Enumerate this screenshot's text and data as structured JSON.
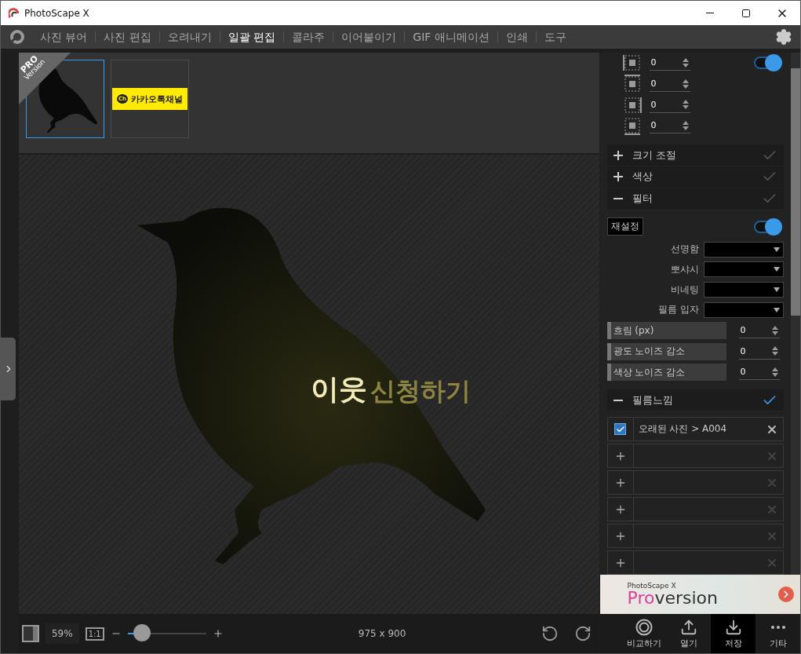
{
  "window": {
    "title": "PhotoScape X"
  },
  "nav": [
    {
      "label": "사진 뷰어",
      "selected": false
    },
    {
      "label": "사진 편집",
      "selected": false
    },
    {
      "label": "오려내기",
      "selected": false
    },
    {
      "label": "일괄 편집",
      "selected": true
    },
    {
      "label": "콜라주",
      "selected": false
    },
    {
      "label": "이어붙이기",
      "selected": false
    },
    {
      "label": "GIF 애니메이션",
      "selected": false
    },
    {
      "label": "인쇄",
      "selected": false
    },
    {
      "label": "도구",
      "selected": false
    }
  ],
  "pro_badge": {
    "title": "PRO",
    "subtitle": "Version"
  },
  "thumbnails": [
    {
      "kind": "bird",
      "selected": true
    },
    {
      "kind": "banner",
      "selected": false,
      "label": "카카오톡채널",
      "logo": "Ch"
    }
  ],
  "image": {
    "caption_1": "이웃",
    "caption_2": "신청하기"
  },
  "zoom": {
    "percent": "59%",
    "actual_size": "1:1",
    "level": 0.18
  },
  "dimensions": "975 x 900",
  "panel": {
    "margins_on": true,
    "margins": [
      {
        "value": "0"
      },
      {
        "value": "0"
      },
      {
        "value": "0"
      },
      {
        "value": "0"
      }
    ],
    "sections": [
      {
        "label": "크기 조절",
        "expanded": false,
        "applied": false
      },
      {
        "label": "색상",
        "expanded": false,
        "applied": false
      },
      {
        "label": "필터",
        "expanded": true,
        "applied": false
      }
    ],
    "filter": {
      "reset": "재설정",
      "on": true,
      "dropdowns": [
        {
          "label": "선명함"
        },
        {
          "label": "뽀샤시"
        },
        {
          "label": "비네팅"
        },
        {
          "label": "필름 입자"
        }
      ],
      "sliders": [
        {
          "label": "흐림 (px)",
          "value": "0"
        },
        {
          "label": "광도 노이즈 감소",
          "value": "0"
        },
        {
          "label": "색상 노이즈 감소",
          "value": "0"
        }
      ]
    },
    "film": {
      "label": "필름느낌",
      "expanded": true,
      "applied": true
    },
    "film_slots": [
      {
        "kind": "effect",
        "checked": true,
        "label": "오래된 사진 > A004"
      },
      {
        "kind": "empty"
      },
      {
        "kind": "empty"
      },
      {
        "kind": "empty"
      },
      {
        "kind": "empty"
      },
      {
        "kind": "empty"
      }
    ]
  },
  "ad": {
    "brand": "PhotoScape X",
    "pro": "Pro",
    "version": "version"
  },
  "actions": [
    {
      "label": "비교하기",
      "selected": false
    },
    {
      "label": "열기",
      "selected": false
    },
    {
      "label": "저장",
      "selected": true
    },
    {
      "label": "기타",
      "selected": false
    }
  ]
}
